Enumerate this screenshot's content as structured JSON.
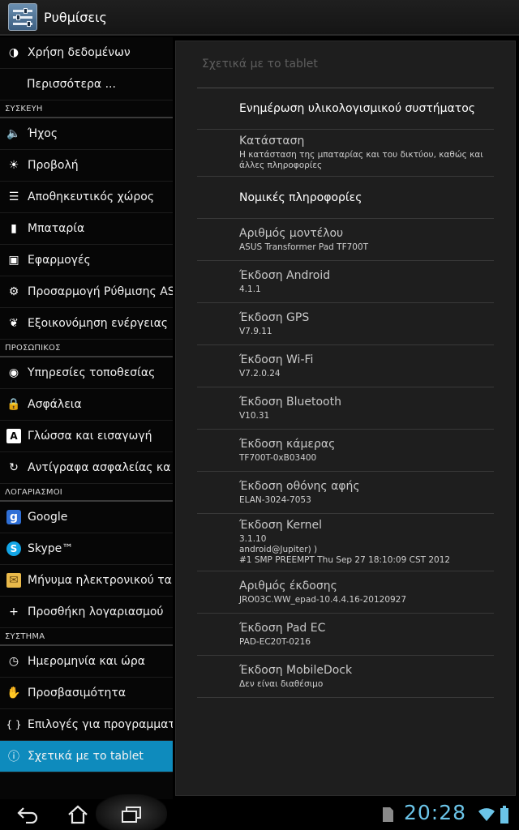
{
  "actionbar": {
    "title": "Ρυθμίσεις",
    "icon": "settings-sliders-icon"
  },
  "sidebar": {
    "items": [
      {
        "label": "Χρήση δεδομένων",
        "icon": "data-usage-icon"
      },
      {
        "label": "Περισσότερα ...",
        "icon": ""
      },
      {
        "header": "ΣΥΣΚΕΥΗ"
      },
      {
        "label": "Ήχος",
        "icon": "sound-icon"
      },
      {
        "label": "Προβολή",
        "icon": "display-icon"
      },
      {
        "label": "Αποθηκευτικός χώρος",
        "icon": "storage-icon"
      },
      {
        "label": "Μπαταρία",
        "icon": "battery-icon"
      },
      {
        "label": "Εφαρμογές",
        "icon": "apps-icon"
      },
      {
        "label": "Προσαρμογή Ρύθμισης AS",
        "icon": "gear-icon"
      },
      {
        "label": "Εξοικονόμηση ενέργειας",
        "icon": "leaf-icon"
      },
      {
        "header": "ΠΡΟΣΩΠΙΚΟΣ"
      },
      {
        "label": "Υπηρεσίες τοποθεσίας",
        "icon": "location-icon"
      },
      {
        "label": "Ασφάλεια",
        "icon": "lock-icon"
      },
      {
        "label": "Γλώσσα και εισαγωγή",
        "icon": "language-icon"
      },
      {
        "label": "Αντίγραφα ασφαλείας κα",
        "icon": "backup-icon"
      },
      {
        "header": "ΛΟΓΑΡΙΑΣΜΟΙ"
      },
      {
        "label": "Google",
        "icon": "google-icon"
      },
      {
        "label": "Skype™",
        "icon": "skype-icon"
      },
      {
        "label": "Μήνυμα ηλεκτρονικού τα",
        "icon": "email-icon"
      },
      {
        "label": "Προσθήκη λογαριασμού",
        "icon": "plus-icon"
      },
      {
        "header": "ΣΥΣΤΗΜΑ"
      },
      {
        "label": "Ημερομηνία και ώρα",
        "icon": "clock-icon"
      },
      {
        "label": "Προσβασιμότητα",
        "icon": "hand-icon"
      },
      {
        "label": "Επιλογές για προγραμματ",
        "icon": "braces-icon"
      },
      {
        "label": "Σχετικά με το tablet",
        "icon": "info-icon",
        "active": true
      }
    ]
  },
  "content": {
    "title": "Σχετικά με το tablet",
    "rows": [
      {
        "title": "Ενημέρωση υλικολογισμικού συστήματος",
        "value": ""
      },
      {
        "title": "Κατάσταση",
        "value": "Η κατάσταση της μπαταρίας και του δικτύου, καθώς και\nάλλες πληροφορίες"
      },
      {
        "title": "Νομικές πληροφορίες",
        "value": ""
      },
      {
        "title": "Αριθμός μοντέλου",
        "value": "ASUS Transformer Pad TF700T"
      },
      {
        "title": "Έκδοση Android",
        "value": "4.1.1"
      },
      {
        "title": "Έκδοση GPS",
        "value": "V7.9.11"
      },
      {
        "title": "Έκδοση Wi-Fi",
        "value": "V7.2.0.24"
      },
      {
        "title": "Έκδοση Bluetooth",
        "value": "V10.31"
      },
      {
        "title": "Έκδοση κάμερας",
        "value": "TF700T-0xB03400"
      },
      {
        "title": "Έκδοση οθόνης αφής",
        "value": "ELAN-3024-7053"
      },
      {
        "title": "Έκδοση Kernel",
        "value": "3.1.10\nandroid@Jupiter) )\n#1 SMP PREEMPT Thu Sep 27 18:10:09 CST 2012"
      },
      {
        "title": "Αριθμός έκδοσης",
        "value": "JRO03C.WW_epad-10.4.4.16-20120927"
      },
      {
        "title": "Έκδοση Pad EC",
        "value": "PAD-EC20T-0216"
      },
      {
        "title": "Έκδοση MobileDock",
        "value": "Δεν είναι διαθέσιμο"
      }
    ]
  },
  "navbar": {
    "back_icon": "back-icon",
    "home_icon": "home-icon",
    "recent_icon": "recent-apps-icon",
    "clock": "20:28",
    "status_icons": [
      "sd-card-icon",
      "wifi-icon",
      "battery-icon"
    ],
    "clock_color": "#6bc4e8",
    "accent": "#0e8bbd"
  }
}
